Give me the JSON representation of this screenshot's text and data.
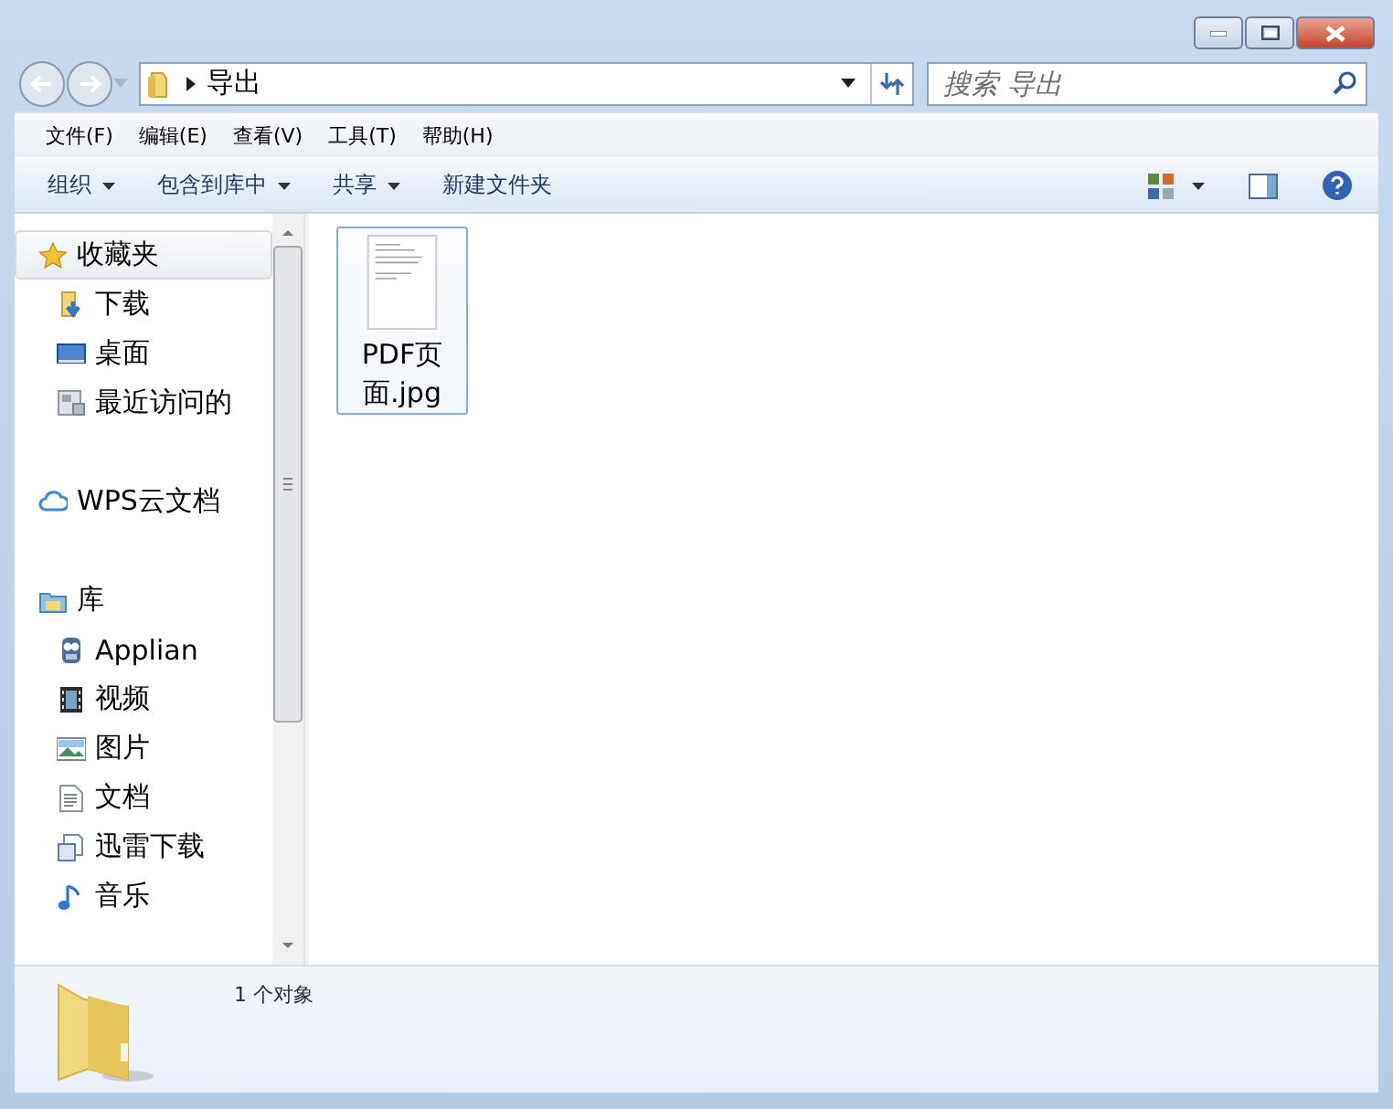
{
  "address": {
    "path": [
      "导出"
    ]
  },
  "search": {
    "placeholder": "搜索 导出"
  },
  "menu": [
    "文件(F)",
    "编辑(E)",
    "查看(V)",
    "工具(T)",
    "帮助(H)"
  ],
  "toolbar": [
    {
      "label": "组织",
      "dropdown": true
    },
    {
      "label": "包含到库中",
      "dropdown": true
    },
    {
      "label": "共享",
      "dropdown": true
    },
    {
      "label": "新建文件夹",
      "dropdown": false
    }
  ],
  "nav": [
    {
      "label": "收藏夹",
      "selected": true,
      "children": [
        {
          "label": "下载",
          "selected": false
        },
        {
          "label": "桌面",
          "selected": false
        },
        {
          "label": "最近访问的",
          "selected": false
        }
      ]
    },
    {
      "label": "WPS云文档",
      "selected": false
    },
    {
      "label": "库",
      "selected": false,
      "children": [
        {
          "label": "Applian",
          "selected": false
        },
        {
          "label": "视频",
          "selected": false
        },
        {
          "label": "图片",
          "selected": false
        },
        {
          "label": "文档",
          "selected": false
        },
        {
          "label": "迅雷下载",
          "selected": false
        },
        {
          "label": "音乐",
          "selected": false
        }
      ]
    }
  ],
  "files": [
    {
      "name": "PDF页面.jpg",
      "selected": true
    }
  ],
  "status": {
    "count": "1 个对象"
  }
}
